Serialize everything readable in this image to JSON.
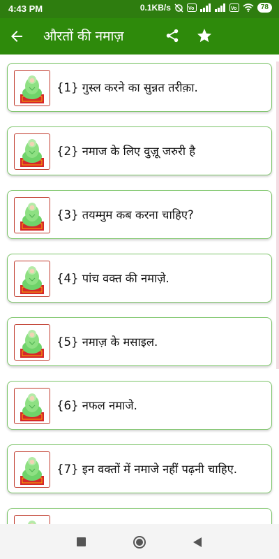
{
  "status_bar": {
    "time": "4:43 PM",
    "network_speed": "0.1KB/s",
    "battery": "78"
  },
  "app_bar": {
    "title": "औरतों की नमाज़",
    "back_icon": "arrow-back-icon",
    "share_icon": "share-icon",
    "favorite_icon": "star-icon"
  },
  "items": [
    {
      "label": "{1} गुस्ल करने का सुन्नत तरीक़ा."
    },
    {
      "label": "{2} नमाज के लिए वुज़ू जरुरी है"
    },
    {
      "label": "{3} तयम्मुम कब करना चाहिए?"
    },
    {
      "label": "{4} पांच वक्त की नमाज़े."
    },
    {
      "label": "{5} नमाज़ के मसाइल."
    },
    {
      "label": "{6} नफल नमाजे."
    },
    {
      "label": "{7} इन वक्तों में नमाजे नहीं पढ़नी चाहिए."
    },
    {
      "label": ""
    }
  ],
  "colors": {
    "app_bar": "#2e8a0b",
    "status_bar": "#2e7d0f",
    "card_border": "#7dc56a",
    "thumb_border": "#c0392b"
  }
}
